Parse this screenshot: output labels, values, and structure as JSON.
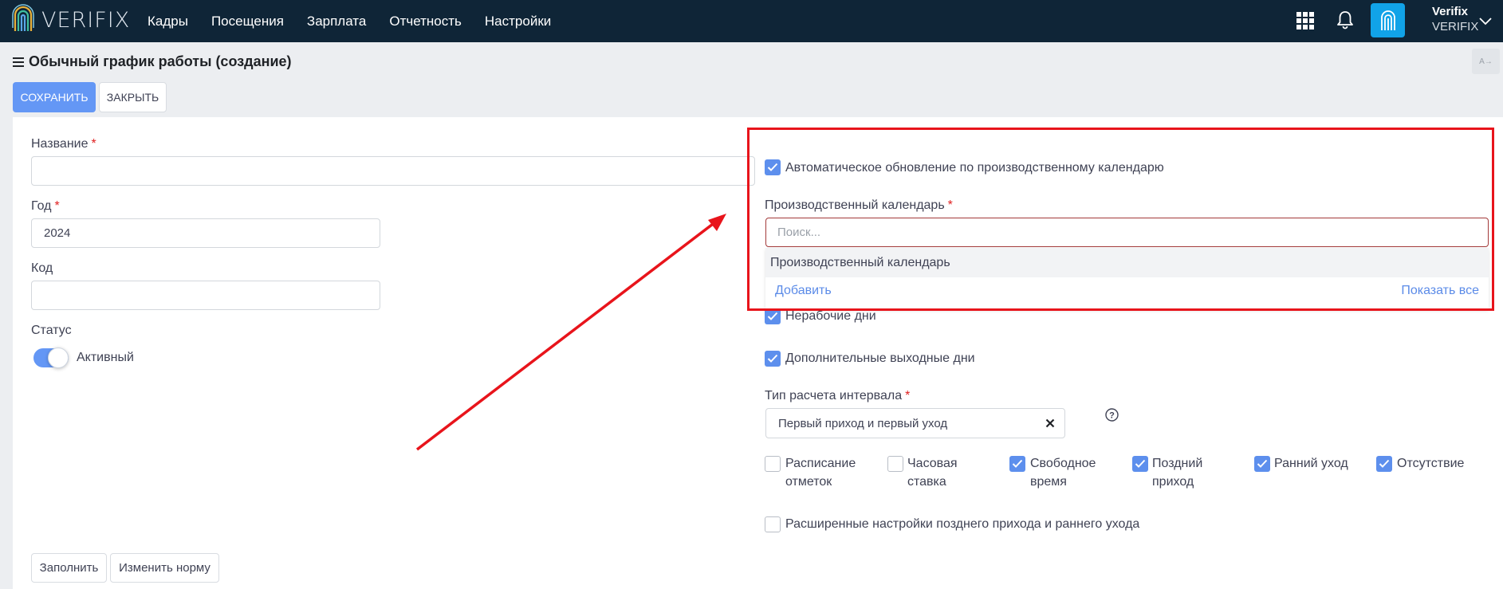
{
  "app": {
    "logo_text": "VERIFIX",
    "user_name": "Verifix",
    "user_org": "VERIFIX"
  },
  "nav": {
    "items": [
      "Кадры",
      "Посещения",
      "Зарплата",
      "Отчетность",
      "Настройки"
    ]
  },
  "page": {
    "title": "Обычный график работы (создание)",
    "lang_label": "A→"
  },
  "toolbar": {
    "save_label": "СОХРАНИТЬ",
    "close_label": "ЗАКРЫТЬ"
  },
  "form": {
    "name_label": "Название",
    "name_value": "",
    "year_label": "Год",
    "year_value": "2024",
    "code_label": "Код",
    "code_value": "",
    "status_label": "Статус",
    "status_value": "Активный",
    "fill_button": "Заполнить",
    "change_norm_button": "Изменить норму"
  },
  "right": {
    "auto_update_label": "Автоматическое обновление по производственному календарю",
    "calendar_label": "Производственный календарь",
    "search_placeholder": "Поиск...",
    "dropdown_option": "Производственный календарь",
    "add_link": "Добавить",
    "show_all_link": "Показать все",
    "nonworking_days_label": "Нерабочие дни",
    "extra_days_off_label": "Дополнительные выходные дни",
    "interval_type_label": "Тип расчета интервала",
    "interval_type_value": "Первый приход и первый уход",
    "options": [
      {
        "line1": "Расписание",
        "line2": "отметок",
        "checked": false
      },
      {
        "line1": "Часовая",
        "line2": "ставка",
        "checked": false
      },
      {
        "line1": "Свободное",
        "line2": "время",
        "checked": true
      },
      {
        "line1": "Поздний",
        "line2": "приход",
        "checked": true
      },
      {
        "line1": "Ранний уход",
        "line2": "",
        "checked": true
      },
      {
        "line1": "Отсутствие",
        "line2": "",
        "checked": true
      }
    ],
    "extended_settings_label": "Расширенные настройки позднего прихода и раннего ухода"
  },
  "colors": {
    "nav_bg": "#0f2537",
    "accent": "#6497f5",
    "annotation": "#e8141b"
  }
}
